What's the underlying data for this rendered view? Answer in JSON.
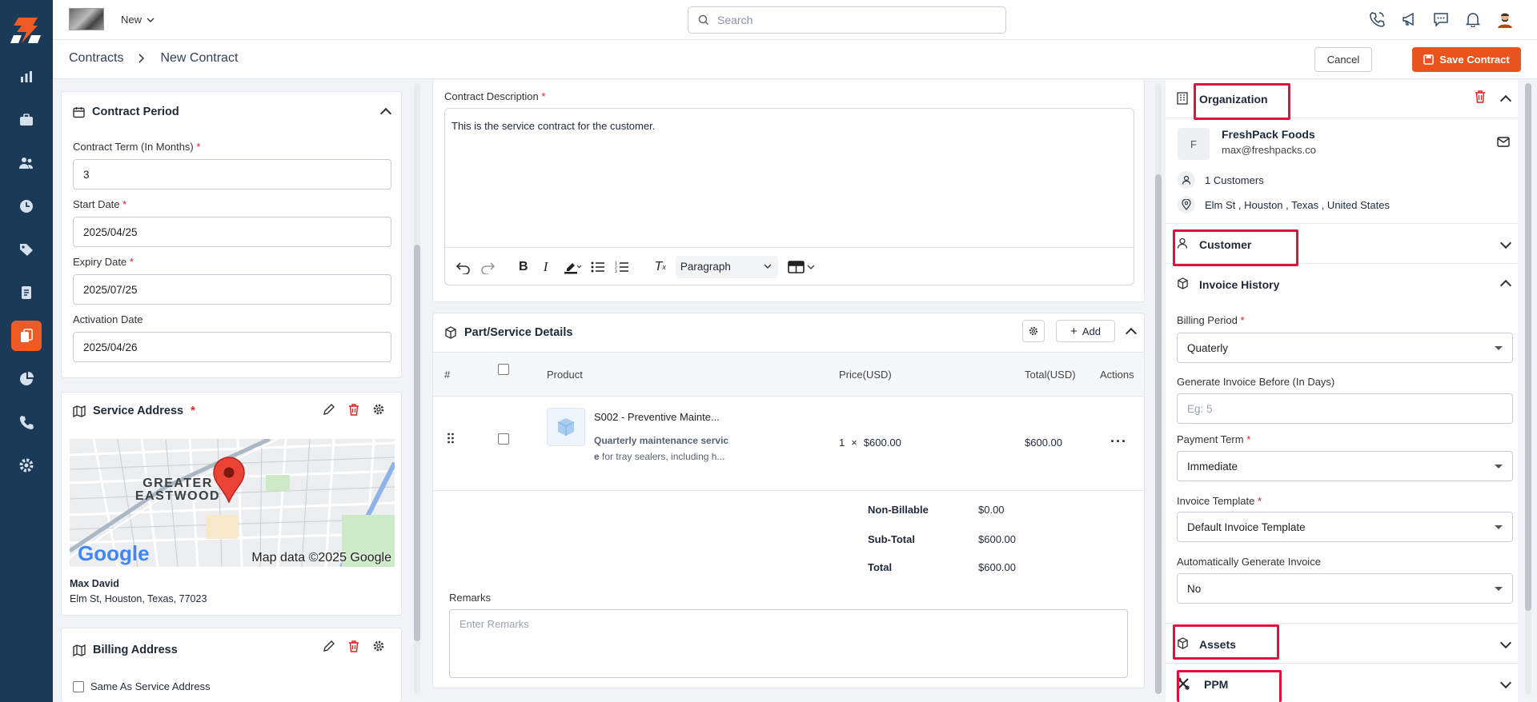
{
  "topbar": {
    "new_label": "New",
    "search_placeholder": "Search"
  },
  "breadcrumb": {
    "root": "Contracts",
    "current": "New Contract"
  },
  "actions": {
    "cancel": "Cancel",
    "save": "Save Contract"
  },
  "contract_period": {
    "title": "Contract Period",
    "term_label": "Contract Term (In Months)",
    "term_value": "3",
    "start_label": "Start Date",
    "start_value": "2025/04/25",
    "expiry_label": "Expiry Date",
    "expiry_value": "2025/07/25",
    "activation_label": "Activation Date",
    "activation_value": "2025/04/26"
  },
  "service_address": {
    "title": "Service Address",
    "map_area": "GREATER EASTWOOD",
    "map_logo": "Google",
    "map_credit": "Map data ©2025 Google",
    "name": "Max David",
    "address": "Elm St, Houston, Texas, 77023"
  },
  "billing_address": {
    "title": "Billing Address",
    "same_as_label": "Same As Service Address"
  },
  "description": {
    "label": "Contract Description",
    "text": "This is the service contract for the customer.",
    "format_value": "Paragraph"
  },
  "parts": {
    "title": "Part/Service Details",
    "add_label": "Add",
    "columns": {
      "num": "#",
      "product": "Product",
      "price": "Price(USD)",
      "total": "Total(USD)",
      "actions": "Actions"
    },
    "row": {
      "name": "S002 - Preventive Mainte...",
      "desc_bold": "Quarterly maintenance servic",
      "desc_bold2": "e",
      "desc_rest": "for tray sealers, including h...",
      "qty": "1",
      "times": "×",
      "price": "$600.00",
      "total": "$600.00"
    },
    "summary": {
      "non_billable_label": "Non-Billable",
      "non_billable": "$0.00",
      "subtotal_label": "Sub-Total",
      "subtotal": "$600.00",
      "total_label": "Total",
      "total": "$600.00"
    },
    "remarks_label": "Remarks",
    "remarks_placeholder": "Enter Remarks"
  },
  "organization": {
    "title": "Organization",
    "avatar_letter": "F",
    "name": "FreshPack Foods",
    "email": "max@freshpacks.co",
    "customers": "1 Customers",
    "address": "Elm St , Houston , Texas , United States"
  },
  "customer": {
    "title": "Customer"
  },
  "invoice_history": {
    "title": "Invoice History",
    "billing_period_label": "Billing Period",
    "billing_period_value": "Quaterly",
    "generate_before_label": "Generate Invoice Before (In Days)",
    "generate_before_placeholder": "Eg: 5",
    "payment_term_label": "Payment Term",
    "payment_term_value": "Immediate",
    "template_label": "Invoice Template",
    "template_value": "Default Invoice Template",
    "auto_label": "Automatically Generate Invoice",
    "auto_value": "No"
  },
  "assets": {
    "title": "Assets"
  },
  "ppm": {
    "title": "PPM"
  },
  "colors": {
    "sidebar": "#1b3a57",
    "accent": "#e9541c",
    "highlight": "#e0113d"
  }
}
